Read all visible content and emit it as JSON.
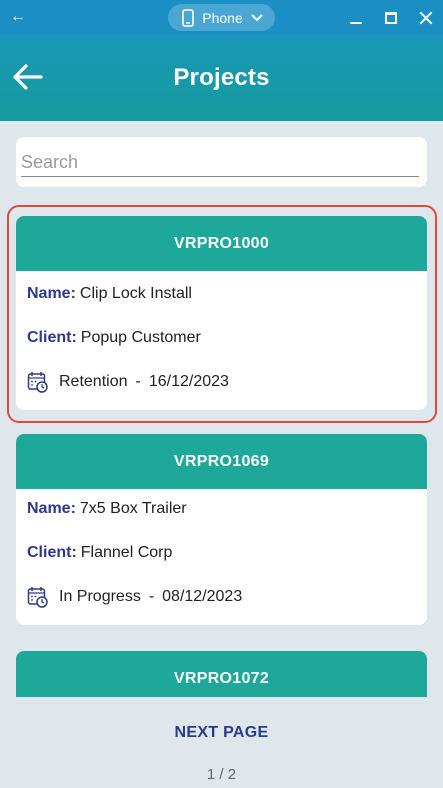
{
  "window": {
    "device_label": "Phone",
    "colors": {
      "titlebar": "#1b8fc4",
      "accent": "#1ea89a",
      "label": "#2d3a8c"
    }
  },
  "header": {
    "title": "Projects"
  },
  "search": {
    "placeholder": "Search",
    "value": ""
  },
  "projects": [
    {
      "code": "VRPRO1000",
      "name_label": "Name:",
      "name": "Clip Lock Install",
      "client_label": "Client:",
      "client": "Popup Customer",
      "status": "Retention",
      "date": "16/12/2023",
      "dash": "-"
    },
    {
      "code": "VRPRO1069",
      "name_label": "Name:",
      "name": "7x5 Box Trailer",
      "client_label": "Client:",
      "client": "Flannel Corp",
      "status": "In Progress",
      "date": "08/12/2023",
      "dash": "-"
    },
    {
      "code": "VRPRO1072"
    }
  ],
  "footer": {
    "next_label": "NEXT PAGE",
    "page_indicator": "1 / 2"
  }
}
